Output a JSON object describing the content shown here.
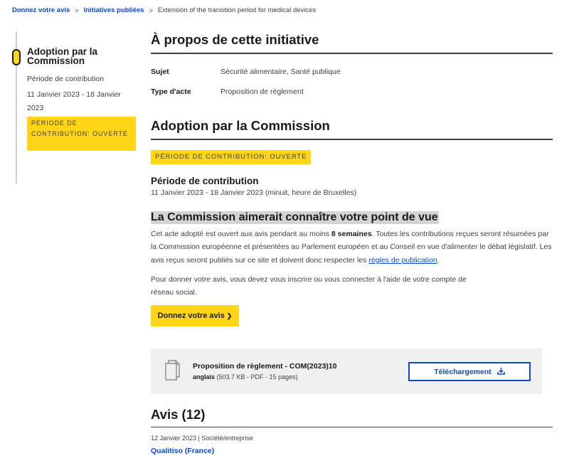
{
  "breadcrumb": {
    "items": [
      "Donnez votre avis",
      "Initiatives publiées"
    ],
    "separator": ">",
    "current": "Extension of the transition period for medical devices"
  },
  "timeline": {
    "step_title": "Adoption par la Commission",
    "period_label": "Période de contribution",
    "period_dates": "11 Janvier 2023 - 18 Janvier 2023",
    "badge": "PÉRIODE DE CONTRIBUTION: OUVERTE"
  },
  "about": {
    "heading": "À propos de cette initiative",
    "rows": [
      {
        "key": "Sujet",
        "value": "Sécurité alimentaire, Santé publique"
      },
      {
        "key": "Type d'acte",
        "value": "Proposition de règlement"
      }
    ]
  },
  "adoption": {
    "heading": "Adoption par la Commission",
    "badge": "PÉRIODE DE CONTRIBUTION: OUVERTE",
    "period_title": "Période de contribution",
    "period_dates": "11 Janvier 2023 - 18 Janvier 2023  (minuit, heure de Bruxelles)"
  },
  "feedback": {
    "heading": "La Commission aimerait connaître votre point de vue",
    "para1_before": "Cet acte adopté est ouvert aux avis pendant au moins ",
    "para1_bold": "8 semaines",
    "para1_after": ". Toutes les contributions reçues seront résumées par la Commission européenne et présentées au Parlement européen et au Conseil en vue d'alimenter le débat législatif. Les avis reçus seront publiés sur ce site et doivent donc respecter les ",
    "para1_link": "règles de publication",
    "para1_end": ".",
    "para2": "Pour donner votre avis, vous devez vous inscrire ou vous connecter à l'aide de votre compte de réseau social.",
    "cta_label": "Donnez votre avis",
    "cta_chevron": "❯"
  },
  "document": {
    "icon": "document-stack-icon",
    "title": "Proposition de règlement - COM(2023)10",
    "language": "anglais",
    "details": " (503.7 KB - PDF - 15 pages)",
    "download_label": "Téléchargement",
    "download_icon": "download-icon"
  },
  "reviews": {
    "heading": "Avis (12)",
    "items": [
      {
        "meta": "12 Janvier 2023 | Société/entreprise",
        "author": "Qualitiso (France)"
      }
    ]
  },
  "colors": {
    "accent_yellow": "#ffd617",
    "link_blue": "#0e47cb",
    "text_dark": "#1a1a1a",
    "text_grey": "#404040",
    "panel_grey": "#f0f0f0"
  }
}
